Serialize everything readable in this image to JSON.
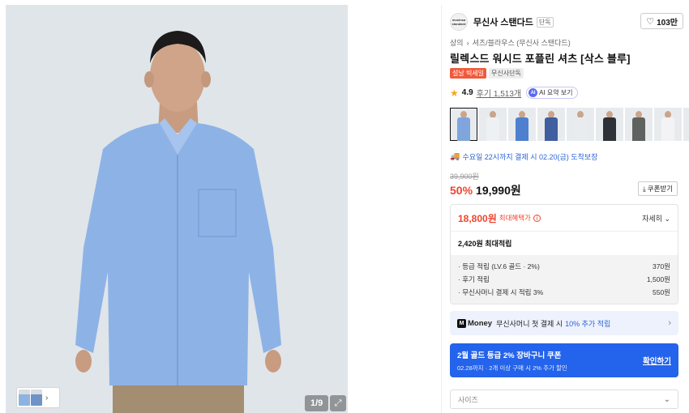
{
  "gallery": {
    "counter": "1/9",
    "expand_icon": "⤢",
    "thumb_chevron": "›"
  },
  "brand": {
    "logo_text": "musinsa standard",
    "name": "무신사 스탠다드",
    "badge": "단독",
    "like_count": "103만"
  },
  "breadcrumb": {
    "level1": "상의",
    "separator": "›",
    "level2": "셔츠/블라우스 (무신사 스탠다드)"
  },
  "product": {
    "title": "릴렉스드 워시드 포플린 셔츠 [삭스 블루]",
    "tag_red": "설날 빅세일",
    "tag_gray": "무신사단독",
    "rating": "4.9",
    "review_text": "후기 1,513개",
    "ai_label": "AI 요약 보기"
  },
  "color_options": [
    {
      "color": "#7fa5dc",
      "selected": true
    },
    {
      "color": "#eef1f4",
      "selected": false
    },
    {
      "color": "#4f7fcf",
      "selected": false
    },
    {
      "color": "#3f5f9e",
      "selected": false
    },
    {
      "color": "#e9ecef",
      "selected": false
    },
    {
      "color": "#2e3136",
      "selected": false
    },
    {
      "color": "#5e6360",
      "selected": false
    },
    {
      "color": "#f3f3f5",
      "selected": false
    },
    {
      "color": "#5d6a52",
      "selected": false
    }
  ],
  "delivery": {
    "text": "수요일 22시까지 결제 시 02.20(금) 도착보장"
  },
  "price": {
    "original": "39,900원",
    "discount": "50%",
    "sale": "19,990원",
    "coupon_button": "쿠폰받기"
  },
  "benefit": {
    "max_price": "18,800원",
    "max_label": "최대혜택가",
    "detail": "자세히",
    "points_total": "2,420원 최대적립",
    "rows": [
      {
        "label": "· 등급 적립 (LV.6 골드 · 2%)",
        "value": "370원"
      },
      {
        "label": "· 후기 적립",
        "value": "1,500원"
      },
      {
        "label": "· 무신사머니 결제 시 적립 3%",
        "value": "550원"
      }
    ]
  },
  "money_banner": {
    "logo": "Money",
    "text": "무신사머니 첫 결제 시",
    "highlight": "10% 추가 적립"
  },
  "coupon_banner": {
    "title": "2월 골드 등급 2% 장바구니 쿠폰",
    "subtitle": "02.28까지 · 2개 이상 구매 시 2% 추가 할인",
    "action": "확인하기"
  },
  "size": {
    "placeholder": "사이즈"
  }
}
